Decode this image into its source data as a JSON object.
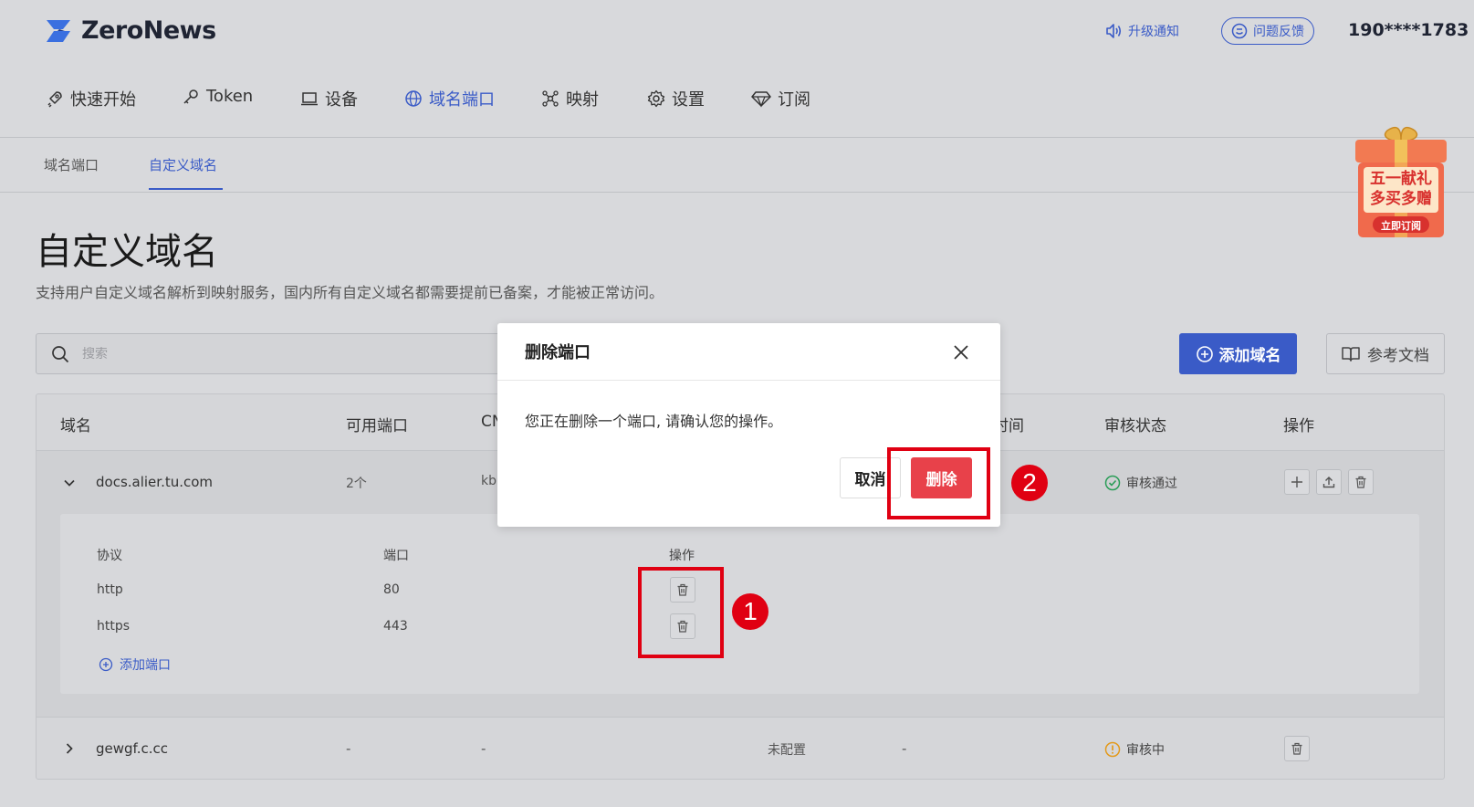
{
  "header": {
    "logo_text": "ZeroNews",
    "upgrade_label": "升级通知",
    "feedback_label": "问题反馈",
    "phone": "190****1783"
  },
  "nav": [
    {
      "label": "快速开始",
      "icon": "rocket-icon"
    },
    {
      "label": "Token",
      "icon": "key-icon"
    },
    {
      "label": "设备",
      "icon": "laptop-icon"
    },
    {
      "label": "域名端口",
      "icon": "globe-icon",
      "active": true
    },
    {
      "label": "映射",
      "icon": "network-icon"
    },
    {
      "label": "设置",
      "icon": "gear-icon"
    },
    {
      "label": "订阅",
      "icon": "diamond-icon"
    }
  ],
  "subtabs": [
    {
      "label": "域名端口"
    },
    {
      "label": "自定义域名",
      "active": true
    }
  ],
  "promo": {
    "line1": "五一献礼",
    "line2": "多买多赠",
    "button": "立即订阅"
  },
  "page": {
    "title": "自定义域名",
    "description": "支持用户自定义域名解析到映射服务，国内所有自定义域名都需要提前已备案，才能被正常访问。"
  },
  "search": {
    "placeholder": "搜索"
  },
  "buttons": {
    "add_domain": "添加域名",
    "docs": "参考文档"
  },
  "table": {
    "columns": [
      "域名",
      "可用端口",
      "CN",
      "时间",
      "审核状态",
      "操作"
    ],
    "rows": [
      {
        "domain": "docs.alier.tu.com",
        "ports": "2个",
        "cname": "kb",
        "status": "审核通过",
        "expanded": true,
        "sub": {
          "columns": [
            "协议",
            "端口",
            "操作"
          ],
          "rows": [
            {
              "protocol": "http",
              "port": "80"
            },
            {
              "protocol": "https",
              "port": "443"
            }
          ],
          "add_port": "添加端口"
        }
      },
      {
        "domain": "gewgf.c.cc",
        "ports": "-",
        "cname": "-",
        "config": "未配置",
        "time": "-",
        "status": "审核中"
      }
    ]
  },
  "modal": {
    "title": "删除端口",
    "message": "您正在删除一个端口, 请确认您的操作。",
    "cancel": "取消",
    "confirm": "删除"
  },
  "annotations": {
    "step1": "1",
    "step2": "2"
  },
  "colors": {
    "accent": "#3a5bc7",
    "danger": "#e8414a",
    "annotation": "#e00012",
    "success": "#2a9d57",
    "warning": "#e39a1c"
  }
}
